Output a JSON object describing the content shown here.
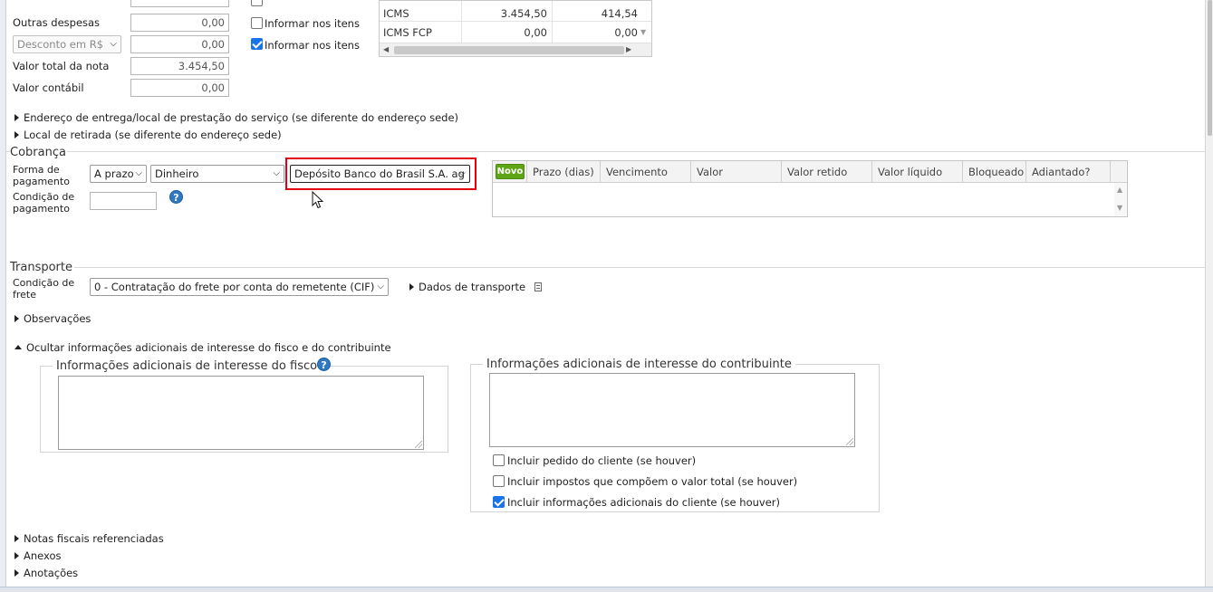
{
  "totals": {
    "outras_despesas": {
      "label": "Outras despesas",
      "value": "0,00"
    },
    "desconto": {
      "select": "Desconto em R$",
      "value": "0,00"
    },
    "valor_total_nota": {
      "label": "Valor total da nota",
      "value": "3.454,50"
    },
    "valor_contabil": {
      "label": "Valor contábil",
      "value": "0,00"
    },
    "informar_itens_1": {
      "label": "Informar nos itens",
      "checked": false
    },
    "informar_itens_2": {
      "label": "Informar nos itens",
      "checked": true
    }
  },
  "taxes": {
    "rows": [
      {
        "name": "ICMS",
        "base": "3.454,50",
        "value": "414,54"
      },
      {
        "name": "ICMS FCP",
        "base": "0,00",
        "value": "0,00"
      }
    ]
  },
  "address_expanders": {
    "endereco_entrega": "Endereço de entrega/local de prestação do serviço (se diferente do endereço sede)",
    "local_retirada": "Local de retirada (se diferente do endereço sede)"
  },
  "cobranca": {
    "title": "Cobrança",
    "forma_pagamento_label": "Forma de pagamento",
    "forma_pagamento_line1": "Forma de",
    "forma_pagamento_line2": "pagamento",
    "prazo_select": "A prazo",
    "meio_select": "Dinheiro",
    "conta_select": "Depósito Banco do Brasil S.A. ag",
    "condicao_line1": "Condição de",
    "condicao_line2": "pagamento",
    "condicao_value": "",
    "help": "?",
    "grid": {
      "novo_label": "Novo",
      "columns": [
        "Prazo (dias)",
        "Vencimento",
        "Valor",
        "Valor retido",
        "Valor líquido",
        "Bloqueado",
        "Adiantado?"
      ]
    }
  },
  "transporte": {
    "title": "Transporte",
    "condicao_line1": "Condição de",
    "condicao_line2": "frete",
    "frete_select": "0 - Contratação do frete por conta do remetente (CIF)",
    "dados_transporte": "Dados de transporte"
  },
  "observacoes": "Observações",
  "info_adicionais": {
    "toggle": "Ocultar informações adicionais de interesse do fisco e do contribuinte",
    "fisco_legend": "Informações adicionais de interesse do fisco",
    "fisco_value": "",
    "contribuinte_legend": "Informações adicionais de interesse do contribuinte",
    "contribuinte_value": "",
    "checks": [
      {
        "label": "Incluir pedido do cliente (se houver)",
        "checked": false
      },
      {
        "label": "Incluir impostos que compõem o valor total (se houver)",
        "checked": false
      },
      {
        "label": "Incluir informações adicionais do cliente (se houver)",
        "checked": true
      }
    ]
  },
  "bottom_expanders": {
    "notas_referenciadas": "Notas fiscais referenciadas",
    "anexos": "Anexos",
    "anotacoes": "Anotações"
  },
  "colors": {
    "accent_blue": "#1a73e8",
    "novo_green": "#5ea516",
    "highlight_red": "#e0000e",
    "help_blue": "#2f78c4"
  }
}
